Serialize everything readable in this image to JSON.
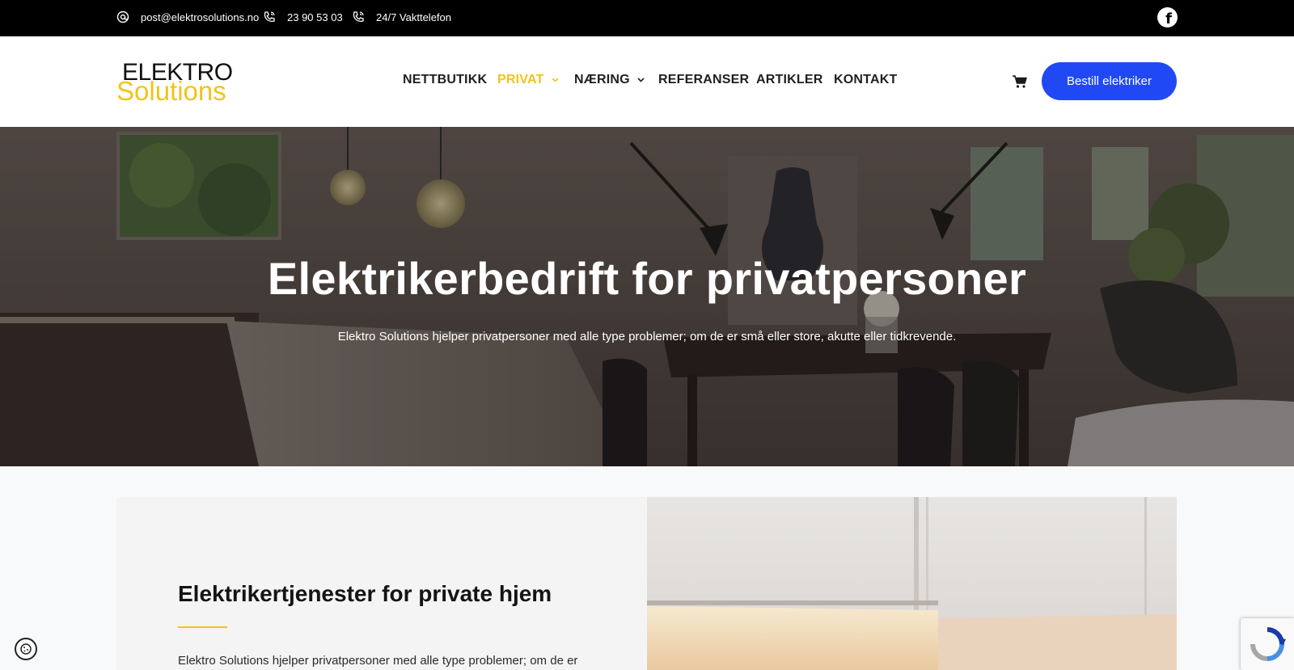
{
  "topbar": {
    "email": "post@elektrosolutions.no",
    "phone": "23 90 53 03",
    "emergency": "24/7 Vakttelefon",
    "icons": [
      "at-icon",
      "phone-icon",
      "phone-icon",
      "facebook-icon"
    ]
  },
  "header": {
    "logo_line1": "ELEKTRO",
    "logo_line2": "Solutions",
    "nav": [
      {
        "label": "NETTBUTIKK",
        "has_dropdown": false,
        "active": false
      },
      {
        "label": "PRIVAT",
        "has_dropdown": true,
        "active": true
      },
      {
        "label": "NÆRING",
        "has_dropdown": true,
        "active": false
      },
      {
        "label": "REFERANSER",
        "has_dropdown": false,
        "active": false
      },
      {
        "label": "ARTIKLER",
        "has_dropdown": false,
        "active": false
      },
      {
        "label": "KONTAKT",
        "has_dropdown": false,
        "active": false
      }
    ],
    "cta_label": "Bestill elektriker"
  },
  "hero": {
    "title": "Elektrikerbedrift for privatpersoner",
    "subtitle": "Elektro Solutions hjelper privatpersoner med alle type problemer; om de er små eller store, akutte eller tidkrevende."
  },
  "section": {
    "heading": "Elektrikertjenester for private hjem",
    "body_start": "Elektro Solutions hjelper privatpersoner med alle type problemer; om de er"
  },
  "colors": {
    "accent_yellow": "#f0c41b",
    "cta_blue": "#2049f5",
    "topbar_bg": "#000000"
  }
}
